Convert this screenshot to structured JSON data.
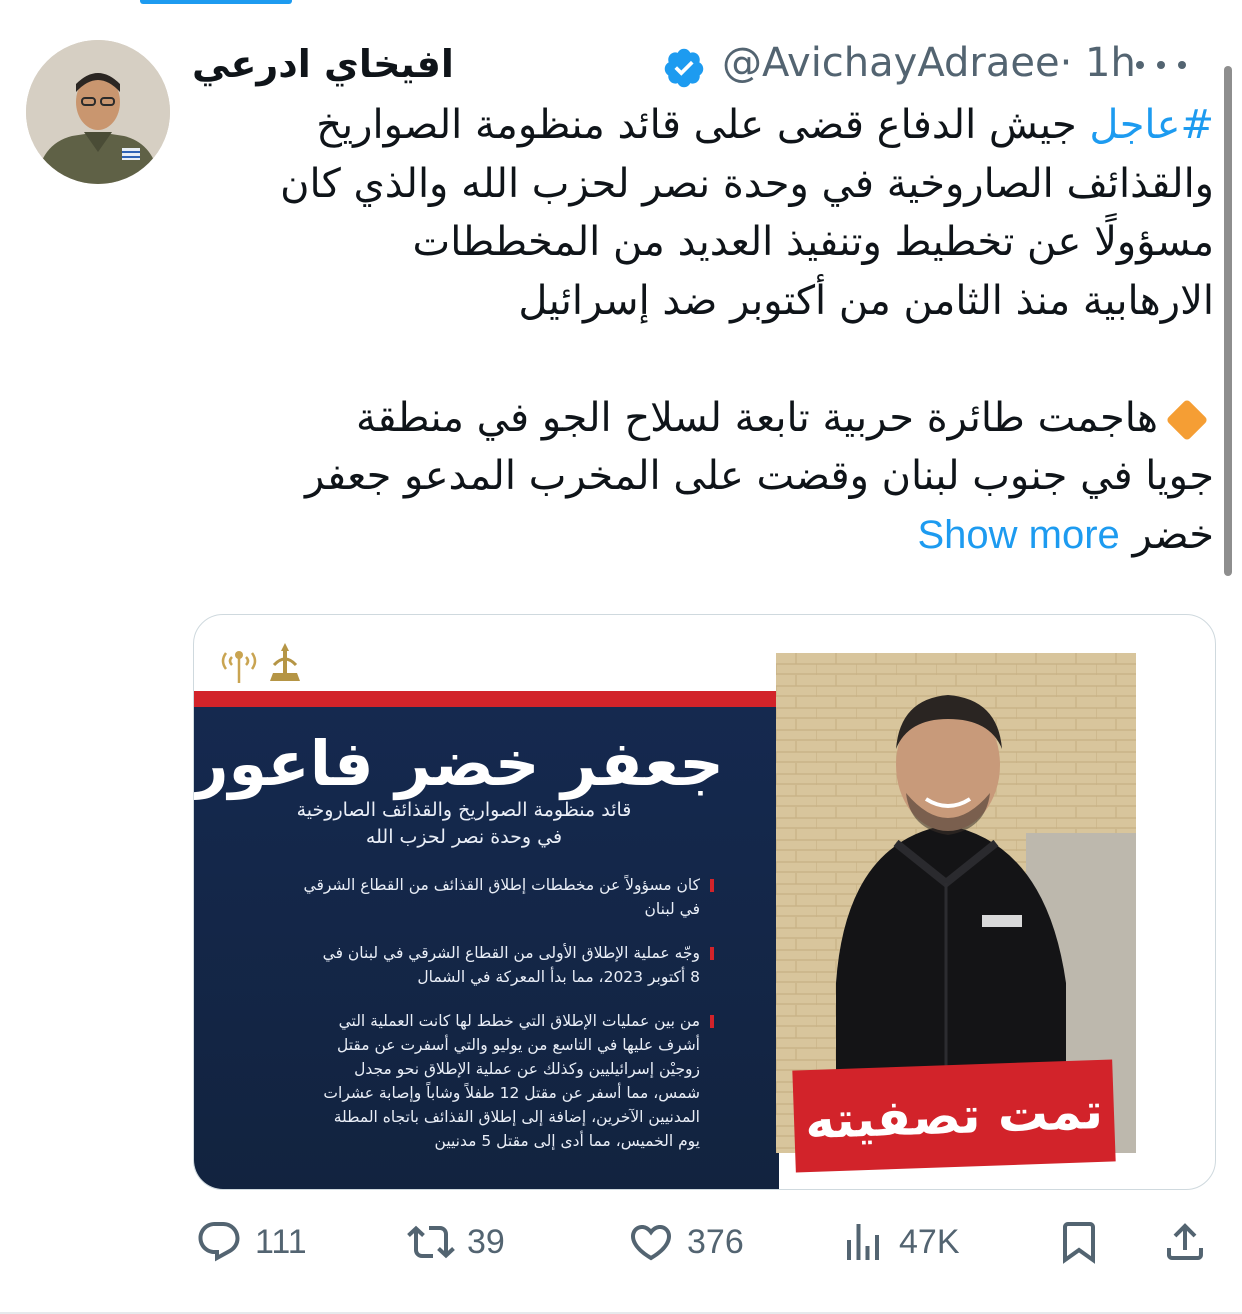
{
  "author": {
    "display_name": "افيخاي ادرعي",
    "handle": "@AvichayAdraee",
    "time": "· 1h",
    "verified": true
  },
  "tweet": {
    "hashtag": "#عاجل",
    "line1_rest": " جيش الدفاع قضى على قائد منظومة الصواريخ",
    "line2": "والقذائف الصاروخية في وحدة نصر لحزب الله والذي كان",
    "line3": "مسؤولًا عن تخطيط وتنفيذ العديد من المخططات",
    "line4": "الارهابية منذ الثامن من أكتوبر ضد إسرائيل",
    "line5": "هاجمت طائرة حربية تابعة لسلاح الجو في منطقة",
    "line6": "جويا في جنوب لبنان وقضت على المخرب المدعو جعفر",
    "line7": "خضر",
    "show_more": "Show more"
  },
  "card": {
    "title": "جعفر خضر فاعور",
    "subtitle_1": "قائد منظومة الصواريخ والقذائف الصاروخية",
    "subtitle_2": "في وحدة نصر لحزب الله",
    "bullet1": [
      "كان مسؤولاً عن مخططات إطلاق القذائف من القطاع الشرقي",
      "في لبنان"
    ],
    "bullet2": [
      "وجّه عملية الإطلاق الأولى من القطاع الشرقي في لبنان في",
      "8 أكتوبر 2023، مما بدأ المعركة في الشمال"
    ],
    "bullet3": [
      "من بين عمليات الإطلاق التي خطط لها كانت العملية التي",
      "أشرف عليها في التاسع من يوليو والتي أسفرت عن مقتل",
      "زوجيْن إسرائيليين وكذلك عن عملية الإطلاق نحو مجدل",
      "شمس، مما أسفر عن مقتل 12 طفلاً وشاباً وإصابة عشرات",
      "المدنيين الآخرين، إضافة إلى إطلاق القذائف باتجاه المطلة",
      "يوم الخميس، مما أدى إلى مقتل 5 مدنيين"
    ],
    "stamp": "تمت تصفيته"
  },
  "actions": {
    "replies": "111",
    "retweets": "39",
    "likes": "376",
    "views": "47K"
  },
  "icons": {
    "reply": "reply-icon",
    "retweet": "retweet-icon",
    "like": "heart-icon",
    "views": "views-icon",
    "bookmark": "bookmark-icon",
    "share": "share-icon",
    "verified": "verified-badge-icon",
    "more": "more-icon"
  },
  "colors": {
    "accent": "#1d9bf0",
    "muted": "#536471",
    "card_navy": "#15294f",
    "card_red": "#d2232a"
  }
}
